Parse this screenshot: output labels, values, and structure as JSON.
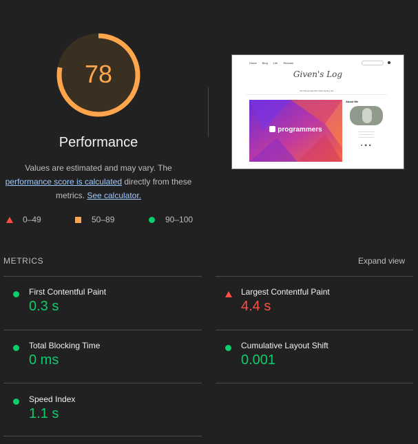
{
  "gauge": {
    "score": "78",
    "title": "Performance",
    "color": "#ffa54b",
    "fraction": 0.78
  },
  "description": {
    "text1": "Values are estimated and may vary. The",
    "link1": "performance score is calculated",
    "text2": "directly from these metrics.",
    "link2": "See calculator."
  },
  "legend": [
    {
      "icon": "triangle-icon",
      "label": "0–49",
      "color": "#ff4e42"
    },
    {
      "icon": "square-icon",
      "label": "50–89",
      "color": "#ffa54b"
    },
    {
      "icon": "circle-icon",
      "label": "90–100",
      "color": "#0cce6b"
    }
  ],
  "thumbnail": {
    "nav": [
      "Home",
      "Blog",
      "Life",
      "Resume"
    ],
    "logo": "Given's Log",
    "tags": "Tech  Book  Algorithm  Web  Spring  Life  ...",
    "banner": "programmers",
    "about": "About Me",
    "icons": "● ◉ ■"
  },
  "metrics": {
    "heading": "METRICS",
    "expand": "Expand view",
    "items": [
      {
        "title": "First Contentful Paint",
        "value": "0.3 s",
        "status": "good"
      },
      {
        "title": "Largest Contentful Paint",
        "value": "4.4 s",
        "status": "bad"
      },
      {
        "title": "Total Blocking Time",
        "value": "0 ms",
        "status": "good"
      },
      {
        "title": "Cumulative Layout Shift",
        "value": "0.001",
        "status": "good"
      },
      {
        "title": "Speed Index",
        "value": "1.1 s",
        "status": "good"
      }
    ]
  }
}
